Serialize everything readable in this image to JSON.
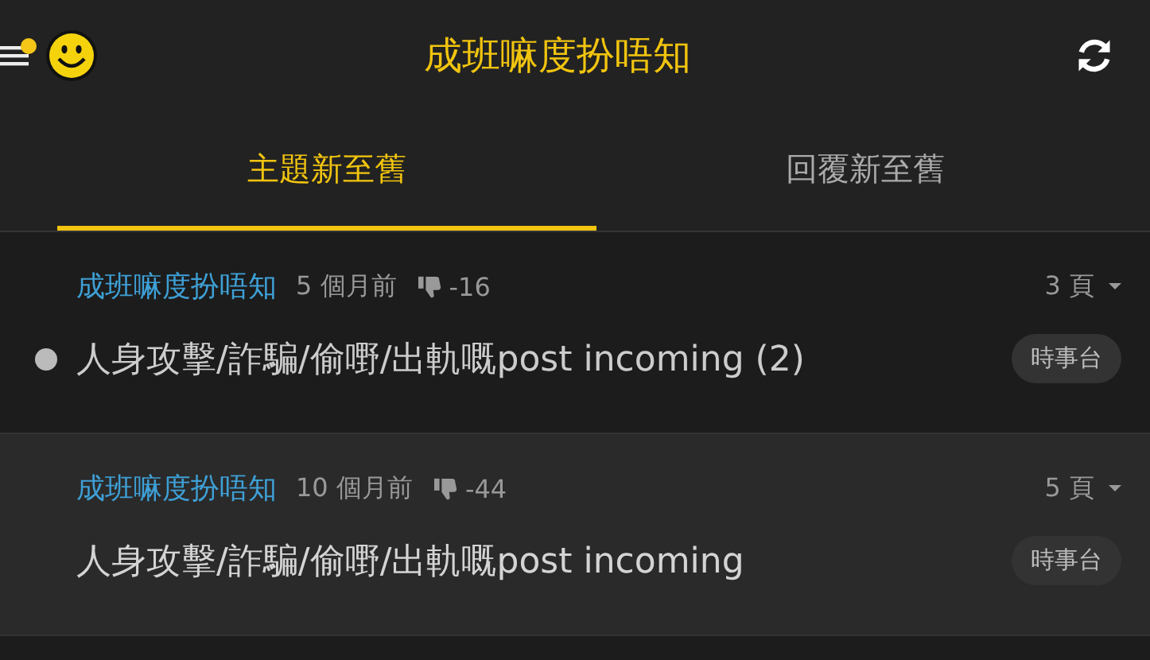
{
  "header": {
    "title": "成班嘛度扮唔知",
    "has_notification": true
  },
  "tabs": [
    {
      "label": "主題新至舊",
      "selected": true
    },
    {
      "label": "回覆新至舊",
      "selected": false
    }
  ],
  "threads": [
    {
      "author": "成班嘛度扮唔知",
      "time": "5 個月前",
      "score": "-16",
      "pages": "3 頁",
      "title": "人身攻擊/詐騙/偷嘢/出軌嘅post incoming (2)",
      "category": "時事台",
      "unread": true,
      "selected": false
    },
    {
      "author": "成班嘛度扮唔知",
      "time": "10 個月前",
      "score": "-44",
      "pages": "5 頁",
      "title": "人身攻擊/詐騙/偷嘢/出軌嘅post incoming",
      "category": "時事台",
      "unread": false,
      "selected": true
    }
  ]
}
